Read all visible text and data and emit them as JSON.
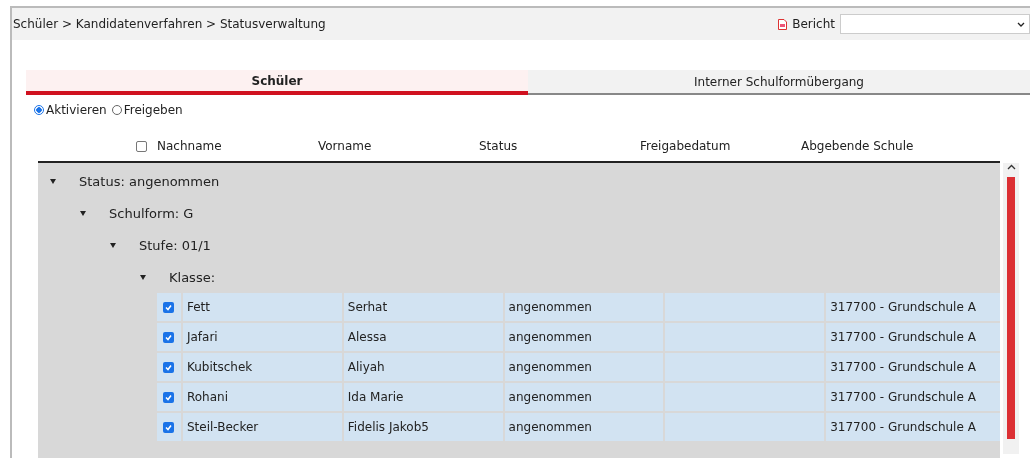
{
  "breadcrumb": "Schüler > Kandidatenverfahren > Statusverwaltung",
  "report": {
    "label": "Bericht"
  },
  "tabs": [
    {
      "label": "Schüler",
      "selected": true
    },
    {
      "label": "Interner Schulformübergang",
      "selected": false
    }
  ],
  "modes": [
    {
      "label": "Aktivieren",
      "selected": true
    },
    {
      "label": "Freigeben",
      "selected": false
    }
  ],
  "table": {
    "select_all": {
      "checked": false
    },
    "columns": [
      "Nachname",
      "Vorname",
      "Status",
      "Freigabedatum",
      "Abgebende Schule"
    ],
    "groups": [
      {
        "label": "Status: angenommen",
        "expanded": true,
        "children": [
          {
            "label": "Schulform: G",
            "expanded": true,
            "children": [
              {
                "label": "Stufe: 01/1",
                "expanded": true,
                "children": [
                  {
                    "label": "Klasse:",
                    "expanded": true,
                    "rows": [
                      {
                        "checked": true,
                        "cells": [
                          "Fett",
                          "Serhat",
                          "angenommen",
                          "",
                          "317700 - Grundschule A"
                        ]
                      },
                      {
                        "checked": true,
                        "cells": [
                          "Jafari",
                          "Alessa",
                          "angenommen",
                          "",
                          "317700 - Grundschule A"
                        ]
                      },
                      {
                        "checked": true,
                        "cells": [
                          "Kubitschek",
                          "Aliyah",
                          "angenommen",
                          "",
                          "317700 - Grundschule A"
                        ]
                      },
                      {
                        "checked": true,
                        "cells": [
                          "Rohani",
                          "Ida Marie",
                          "angenommen",
                          "",
                          "317700 - Grundschule A"
                        ]
                      },
                      {
                        "checked": true,
                        "cells": [
                          "Steil-Becker",
                          "Fidelis Jakob5",
                          "angenommen",
                          "",
                          "317700 - Grundschule A"
                        ]
                      }
                    ]
                  }
                ]
              }
            ]
          }
        ]
      }
    ]
  }
}
